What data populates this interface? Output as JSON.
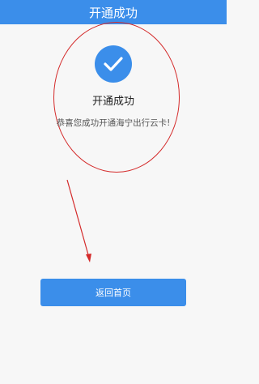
{
  "header": {
    "title": "开通成功"
  },
  "result": {
    "icon": "checkmark-icon",
    "title": "开通成功",
    "message": "恭喜您成功开通海宁出行云卡!"
  },
  "actions": {
    "home_label": "返回首页"
  },
  "colors": {
    "primary": "#3b8eea",
    "annotation": "#d42a2a",
    "background": "#f7f7f7"
  }
}
